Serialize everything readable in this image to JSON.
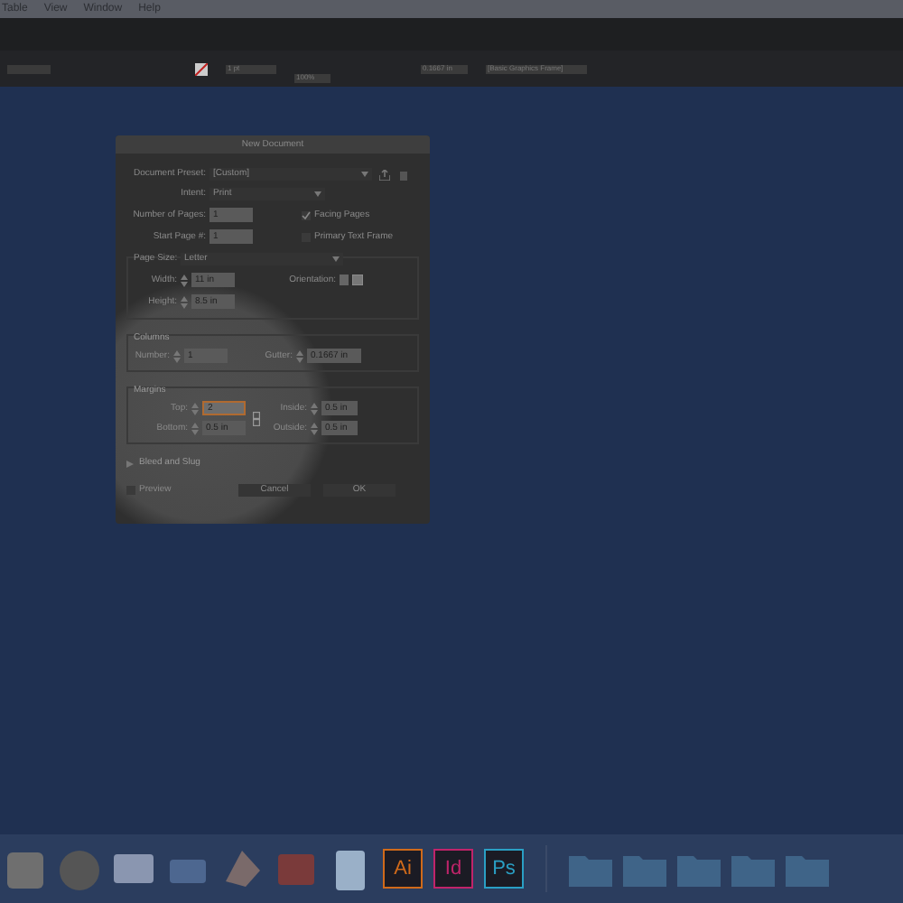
{
  "menu_bar": [
    "Table",
    "View",
    "Window",
    "Help"
  ],
  "toolbar": {
    "stroke_weight": "1 pt",
    "opacity": "100%",
    "offset": "0.1667 in",
    "object_style": "[Basic Graphics Frame]"
  },
  "dialog": {
    "title": "New Document",
    "preset": {
      "label": "Document Preset:",
      "value": "[Custom]"
    },
    "intent": {
      "label": "Intent:",
      "value": "Print"
    },
    "pages": {
      "label": "Number of Pages:",
      "value": "1"
    },
    "start_page": {
      "label": "Start Page #:",
      "value": "1"
    },
    "facing_pages": {
      "label": "Facing Pages",
      "checked": true
    },
    "primary_text_frame": {
      "label": "Primary Text Frame",
      "checked": false
    },
    "page_size": {
      "label": "Page Size:",
      "value": "Letter"
    },
    "width": {
      "label": "Width:",
      "value": "11 in"
    },
    "height": {
      "label": "Height:",
      "value": "8.5 in"
    },
    "orientation": {
      "label": "Orientation:"
    },
    "columns": {
      "title": "Columns",
      "number_label": "Number:",
      "number": "1",
      "gutter_label": "Gutter:",
      "gutter": "0.1667 in"
    },
    "margins": {
      "title": "Margins",
      "fields": [
        {
          "label": "Top:",
          "value": "2",
          "focused": true
        },
        {
          "label": "Bottom:",
          "value": "0.5 in",
          "focused": false
        },
        {
          "label": "Inside:",
          "value": "0.5 in",
          "focused": false
        },
        {
          "label": "Outside:",
          "value": "0.5 in",
          "focused": false
        }
      ]
    },
    "bleed": {
      "label": "Bleed and Slug",
      "expanded": false
    },
    "preview": {
      "label": "Preview",
      "checked": false
    },
    "buttons": [
      "Cancel",
      "OK"
    ]
  },
  "dock_apps": [
    {
      "label": "Ai",
      "color": "#d06a1a"
    },
    {
      "label": "Id",
      "color": "#c0246a"
    },
    {
      "label": "Ps",
      "color": "#2a9fc4"
    }
  ]
}
